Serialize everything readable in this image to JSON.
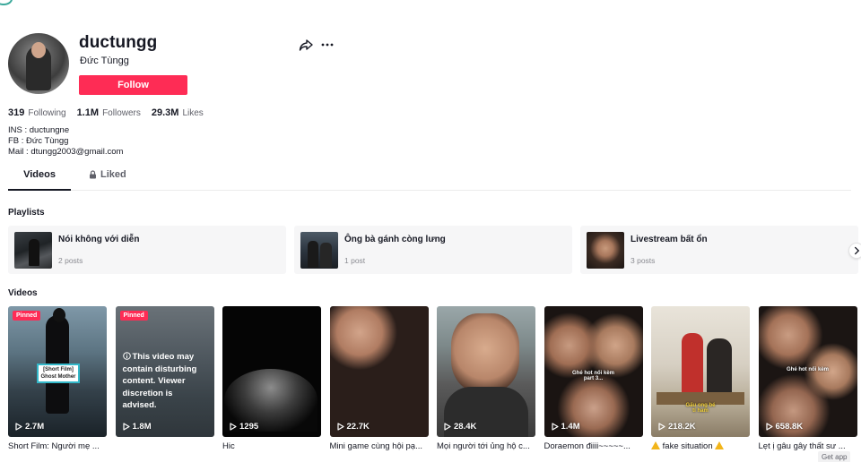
{
  "profile": {
    "username": "ductungg",
    "nickname": "Đức Tùngg",
    "follow_label": "Follow",
    "stats": [
      {
        "value": "319",
        "label": "Following"
      },
      {
        "value": "1.1M",
        "label": "Followers"
      },
      {
        "value": "29.3M",
        "label": "Likes"
      }
    ],
    "bio": [
      "INS : ductungne",
      "FB : Đức Tùngg",
      "Mail : dtungg2003@gmail.com"
    ]
  },
  "tabs": [
    {
      "label": "Videos",
      "active": true
    },
    {
      "label": "Liked",
      "active": false,
      "icon": "lock-icon"
    }
  ],
  "playlists": {
    "title": "Playlists",
    "items": [
      {
        "title": "Nói không với diễn",
        "count": "2 posts"
      },
      {
        "title": "Ông bà gánh còng lưng",
        "count": "1 post"
      },
      {
        "title": "Livestream bất ổn",
        "count": "3 posts"
      }
    ]
  },
  "videos": {
    "title": "Videos",
    "items": [
      {
        "views": "2.7M",
        "caption": "Short Film: Người mẹ ...",
        "badge": "Pinned",
        "overlay": "[Short Film]\nGhost Mother"
      },
      {
        "views": "1.8M",
        "caption": "",
        "badge": "Pinned",
        "warning": "This video may contain disturbing content. Viewer discretion is advised."
      },
      {
        "views": "1295",
        "caption": "Hic"
      },
      {
        "views": "22.7K",
        "caption": "Mini game cùng hội pạ..."
      },
      {
        "views": "28.4K",
        "caption": "Mọi người tới ủng hộ c..."
      },
      {
        "views": "1.4M",
        "caption": "Doraemon điiii~~~~~...",
        "overlay": "Ghé hot nối kèm\npart 3..."
      },
      {
        "views": "218.2K",
        "caption": "fake situation",
        "overlay": "Gấu ong bé\ntí ham"
      },
      {
        "views": "658.8K",
        "caption": "Lẹt ị gâu gây thất sư ...",
        "overlay": "Ghé hot nối kèm"
      }
    ]
  },
  "footer": {
    "get_app": "Get app"
  },
  "colors": {
    "accent": "#fe2c55",
    "text": "#161823",
    "muted": "#60616a"
  }
}
